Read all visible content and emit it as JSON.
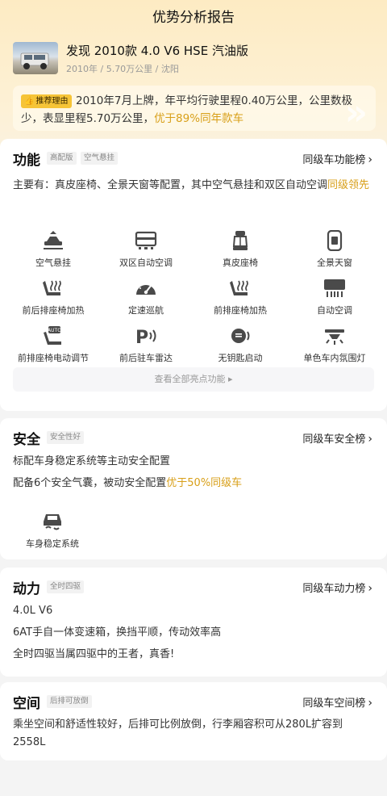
{
  "header": {
    "title": "优势分析报告"
  },
  "car": {
    "name": "发现 2010款 4.0 V6 HSE 汽油版",
    "meta": "2010年 / 5.70万公里 / 沈阳"
  },
  "reason": {
    "badge": "推荐理由",
    "text": "2010年7月上牌，年平均行驶里程0.40万公里，公里数极少，表显里程5.70万公里，",
    "highlight": "优于89%同年款车"
  },
  "features": {
    "title": "功能",
    "tags": [
      "高配版",
      "空气悬挂"
    ],
    "rank_link": "同级车功能榜",
    "summary": "主要有：真皮座椅、全景天窗等配置，其中空气悬挂和双区自动空调",
    "summary_highlight": "同级领先",
    "items": [
      {
        "icon": "air-suspension-icon",
        "label": "空气悬挂"
      },
      {
        "icon": "dual-zone-ac-icon",
        "label": "双区自动空调"
      },
      {
        "icon": "leather-seat-icon",
        "label": "真皮座椅"
      },
      {
        "icon": "panoramic-roof-icon",
        "label": "全景天窗"
      },
      {
        "icon": "seat-heating-icon",
        "label": "前后排座椅加热"
      },
      {
        "icon": "cruise-control-icon",
        "label": "定速巡航"
      },
      {
        "icon": "seat-heating-icon",
        "label": "前排座椅加热"
      },
      {
        "icon": "auto-ac-icon",
        "label": "自动空调"
      },
      {
        "icon": "power-seat-icon",
        "label": "前排座椅电动调节"
      },
      {
        "icon": "parking-radar-icon",
        "label": "前后驻车雷达"
      },
      {
        "icon": "keyless-start-icon",
        "label": "无钥匙启动"
      },
      {
        "icon": "ambient-light-icon",
        "label": "单色车内氛围灯"
      }
    ],
    "view_all": "查看全部亮点功能"
  },
  "safety": {
    "title": "安全",
    "tag": "安全性好",
    "rank_link": "同级车安全榜",
    "line1": "标配车身稳定系统等主动安全配置",
    "line2": "配备6个安全气囊，被动安全配置",
    "line2_highlight": "优于50%同级车",
    "items": [
      {
        "icon": "stability-control-icon",
        "label": "车身稳定系统"
      }
    ]
  },
  "power": {
    "title": "动力",
    "tag": "全时四驱",
    "rank_link": "同级车动力榜",
    "lines": [
      "4.0L V6",
      "6AT手自一体变速箱，换挡平顺，传动效率高",
      "全时四驱当属四驱中的王者，真香!"
    ]
  },
  "space": {
    "title": "空间",
    "tag": "后排可放倒",
    "rank_link": "同级车空间榜",
    "text": "乘坐空间和舒适性较好，后排可比例放倒，行李厢容积可从280L扩容到2558L"
  },
  "colors": {
    "accent": "#d89f18",
    "badge": "#f6c437",
    "icon": "#4a4a4a"
  }
}
